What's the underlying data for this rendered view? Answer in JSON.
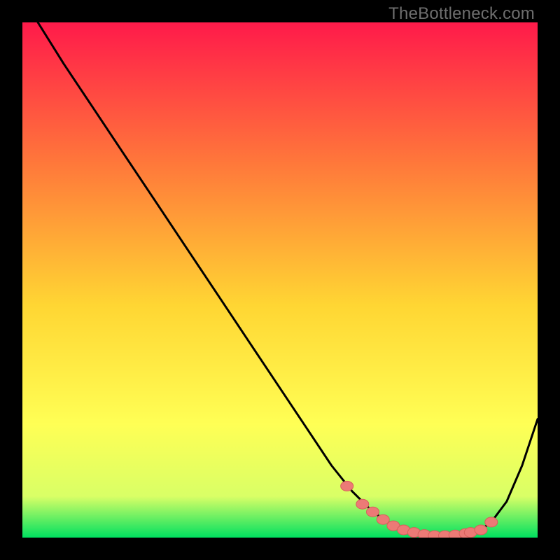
{
  "watermark": "TheBottleneck.com",
  "colors": {
    "gradient_top": "#ff1a4a",
    "gradient_mid1": "#ff7a3a",
    "gradient_mid2": "#ffd633",
    "gradient_mid3": "#ffff55",
    "gradient_mid4": "#d9ff66",
    "gradient_bottom": "#00e060",
    "curve": "#000000",
    "marker_fill": "#ec7a76",
    "marker_stroke": "#d85f5b"
  },
  "chart_data": {
    "type": "line",
    "title": "",
    "xlabel": "",
    "ylabel": "",
    "xlim": [
      0,
      100
    ],
    "ylim": [
      0,
      100
    ],
    "series": [
      {
        "name": "bottleneck-curve",
        "x": [
          3,
          8,
          14,
          20,
          26,
          32,
          38,
          44,
          50,
          56,
          60,
          64,
          68,
          71,
          73,
          75,
          77,
          79,
          81,
          83,
          85,
          87,
          89,
          91,
          94,
          97,
          100
        ],
        "y": [
          100,
          92,
          83,
          74,
          65,
          56,
          47,
          38,
          29,
          20,
          14,
          9,
          5,
          3,
          2,
          1.2,
          0.8,
          0.5,
          0.4,
          0.4,
          0.5,
          0.8,
          1.5,
          3,
          7,
          14,
          23
        ]
      }
    ],
    "markers": {
      "name": "highlighted-points",
      "x": [
        63,
        66,
        68,
        70,
        72,
        74,
        76,
        78,
        80,
        82,
        84,
        86,
        87,
        89,
        91
      ],
      "y": [
        10,
        6.5,
        5,
        3.5,
        2.3,
        1.5,
        1.0,
        0.6,
        0.4,
        0.4,
        0.5,
        0.8,
        1.0,
        1.5,
        3.0
      ]
    }
  }
}
